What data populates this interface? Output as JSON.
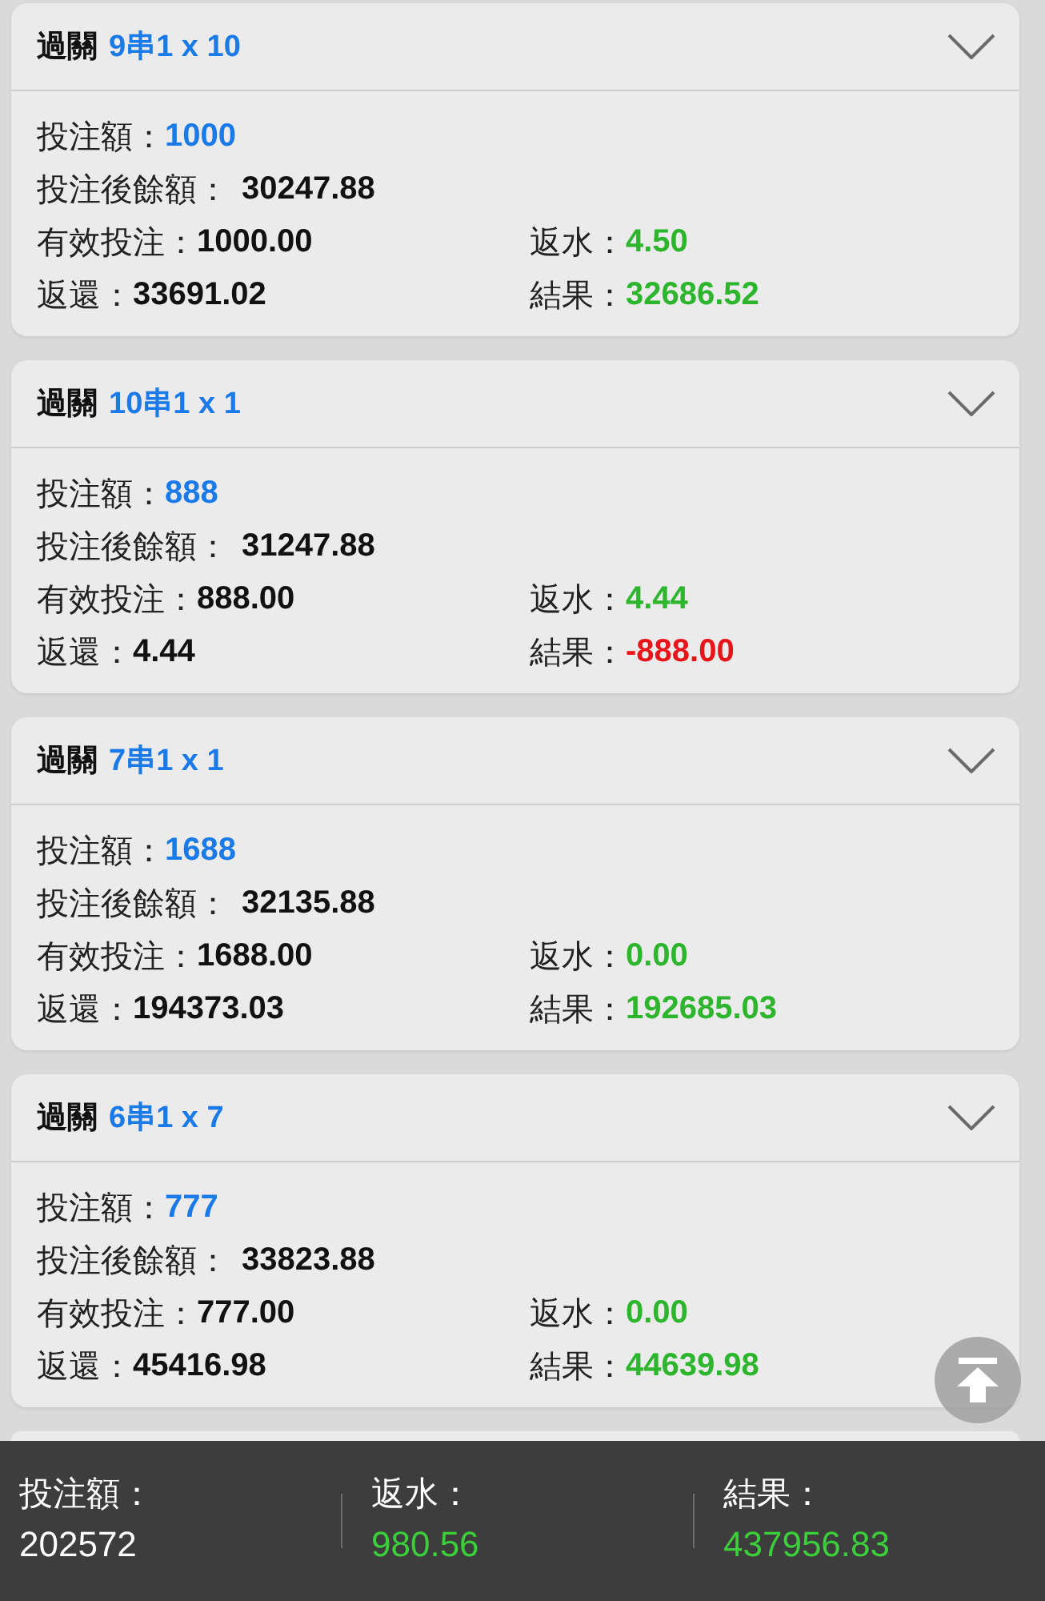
{
  "cards": [
    {
      "category": "過關",
      "bet_type": "9串1 x 10",
      "fields": [
        {
          "kind": "stake",
          "label": "投注額：",
          "value": "1000",
          "color": "#1a7ae8"
        },
        {
          "kind": "balance",
          "label": "投注後餘額：",
          "value": "30247.88",
          "color": "#111111"
        },
        {
          "kind": "valid",
          "label": "有效投注：",
          "value": "1000.00",
          "color": "#111111"
        },
        {
          "kind": "rebate",
          "label": "返水：",
          "value": "4.50",
          "color": "#2db52d"
        },
        {
          "kind": "return",
          "label": "返還：",
          "value": "33691.02",
          "color": "#111111"
        },
        {
          "kind": "result",
          "label": "結果：",
          "value": "32686.52",
          "color": "#2db52d"
        }
      ]
    },
    {
      "category": "過關",
      "bet_type": "10串1 x 1",
      "fields": [
        {
          "kind": "stake",
          "label": "投注額：",
          "value": "888",
          "color": "#1a7ae8"
        },
        {
          "kind": "balance",
          "label": "投注後餘額：",
          "value": "31247.88",
          "color": "#111111"
        },
        {
          "kind": "valid",
          "label": "有效投注：",
          "value": "888.00",
          "color": "#111111"
        },
        {
          "kind": "rebate",
          "label": "返水：",
          "value": "4.44",
          "color": "#2db52d"
        },
        {
          "kind": "return",
          "label": "返還：",
          "value": "4.44",
          "color": "#111111"
        },
        {
          "kind": "result",
          "label": "結果：",
          "value": "-888.00",
          "color": "#e8141a"
        }
      ]
    },
    {
      "category": "過關",
      "bet_type": "7串1 x 1",
      "fields": [
        {
          "kind": "stake",
          "label": "投注額：",
          "value": "1688",
          "color": "#1a7ae8"
        },
        {
          "kind": "balance",
          "label": "投注後餘額：",
          "value": "32135.88",
          "color": "#111111"
        },
        {
          "kind": "valid",
          "label": "有效投注：",
          "value": "1688.00",
          "color": "#111111"
        },
        {
          "kind": "rebate",
          "label": "返水：",
          "value": "0.00",
          "color": "#2db52d"
        },
        {
          "kind": "return",
          "label": "返還：",
          "value": "194373.03",
          "color": "#111111"
        },
        {
          "kind": "result",
          "label": "結果：",
          "value": "192685.03",
          "color": "#2db52d"
        }
      ]
    },
    {
      "category": "過關",
      "bet_type": "6串1 x 7",
      "fields": [
        {
          "kind": "stake",
          "label": "投注額：",
          "value": "777",
          "color": "#1a7ae8"
        },
        {
          "kind": "balance",
          "label": "投注後餘額：",
          "value": "33823.88",
          "color": "#111111"
        },
        {
          "kind": "valid",
          "label": "有效投注：",
          "value": "777.00",
          "color": "#111111"
        },
        {
          "kind": "rebate",
          "label": "返水：",
          "value": "0.00",
          "color": "#2db52d"
        },
        {
          "kind": "return",
          "label": "返還：",
          "value": "45416.98",
          "color": "#111111"
        },
        {
          "kind": "result",
          "label": "結果：",
          "value": "44639.98",
          "color": "#2db52d"
        }
      ]
    }
  ],
  "totals": [
    {
      "label": "投注額：",
      "value": "202572",
      "color": "#ffffff"
    },
    {
      "label": "返水：",
      "value": "980.56",
      "color": "#3ccf3c"
    },
    {
      "label": "結果：",
      "value": "437956.83",
      "color": "#3ccf3c"
    }
  ]
}
